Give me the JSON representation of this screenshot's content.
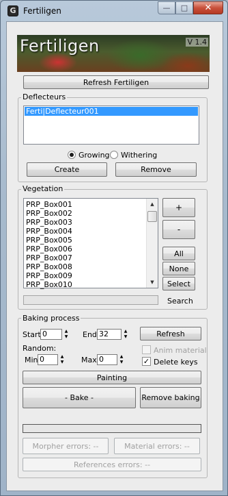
{
  "window": {
    "title": "Fertiligen"
  },
  "banner": {
    "title": "Fertiligen",
    "version": "V 1.4"
  },
  "refresh_button": "Refresh Fertiligen",
  "deflecteurs": {
    "group_label": "Deflecteurs",
    "items": [
      "Ferti|Deflecteur001"
    ],
    "growing_label": "Growing",
    "withering_label": "Withering",
    "mode": "Growing",
    "create_label": "Create",
    "remove_label": "Remove"
  },
  "vegetation": {
    "group_label": "Vegetation",
    "items": [
      "PRP_Box001",
      "PRP_Box002",
      "PRP_Box003",
      "PRP_Box004",
      "PRP_Box005",
      "PRP_Box006",
      "PRP_Box007",
      "PRP_Box008",
      "PRP_Box009",
      "PRP_Box010"
    ],
    "add_label": "+",
    "remove_label": "-",
    "all_label": "All",
    "none_label": "None",
    "select_label": "Select",
    "search_value": "",
    "search_label": "Search"
  },
  "baking": {
    "group_label": "Baking process",
    "start_label": "Start",
    "start_value": "0",
    "end_label": "End",
    "end_value": "32",
    "refresh_label": "Refresh",
    "random_label": "Random:",
    "min_label": "Min",
    "min_value": "0",
    "max_label": "Max",
    "max_value": "0",
    "anim_material_label": "Anim material",
    "anim_material_checked": false,
    "delete_keys_label": "Delete keys",
    "delete_keys_checked": true,
    "painting_label": "Painting",
    "bake_label": "- Bake -",
    "remove_baking_label": "Remove baking",
    "progress": 0,
    "morpher_errors_label": "Morpher errors: --",
    "material_errors_label": "Material errors: --",
    "references_errors_label": "References errors: --"
  }
}
